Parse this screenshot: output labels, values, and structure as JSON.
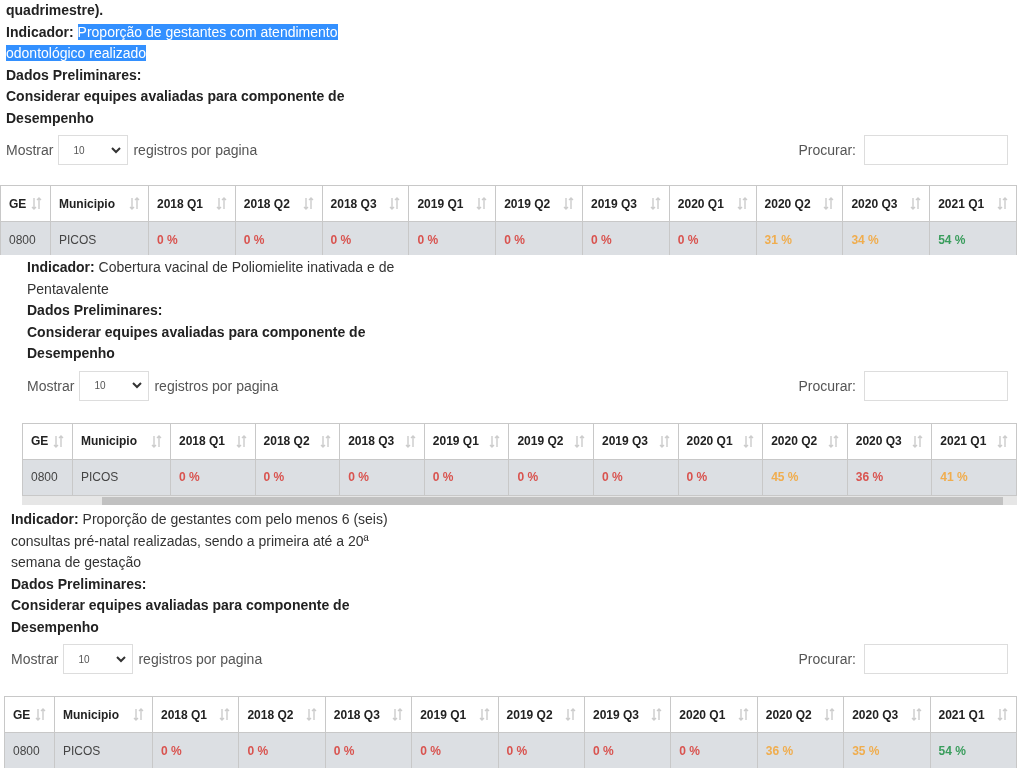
{
  "panels": [
    {
      "lead": "quadrimestre).",
      "indicator_label": "Indicador:",
      "indicator_text": "Proporção de gestantes com atendimento odontológico realizado",
      "indicator_selected": true,
      "notes": [
        "Dados Preliminares:",
        "Considerar equipes avaliadas para componente de Desempenho"
      ],
      "show_label": "Mostrar",
      "page_size": "10",
      "show_suffix": "registros por pagina",
      "search_label": "Procurar:",
      "columns": [
        "GE",
        "Municipio",
        "2018 Q1",
        "2018 Q2",
        "2018 Q3",
        "2019 Q1",
        "2019 Q2",
        "2019 Q3",
        "2020 Q1",
        "2020 Q2",
        "2020 Q3",
        "2021 Q1"
      ],
      "rows": [
        {
          "cells": [
            {
              "text": "0800"
            },
            {
              "text": "PICOS"
            },
            {
              "text": "0 %",
              "color": "#d9534f"
            },
            {
              "text": "0 %",
              "color": "#d9534f"
            },
            {
              "text": "0 %",
              "color": "#d9534f"
            },
            {
              "text": "0 %",
              "color": "#d9534f"
            },
            {
              "text": "0 %",
              "color": "#d9534f"
            },
            {
              "text": "0 %",
              "color": "#d9534f"
            },
            {
              "text": "0 %",
              "color": "#d9534f"
            },
            {
              "text": "31 %",
              "color": "#f0ad4e"
            },
            {
              "text": "34 %",
              "color": "#f0ad4e"
            },
            {
              "text": "54 %",
              "color": "#3a9d5d"
            }
          ]
        }
      ]
    },
    {
      "indicator_label": "Indicador:",
      "indicator_text": "Cobertura vacinal de Poliomielite inativada e de Pentavalente",
      "indicator_selected": false,
      "notes": [
        "Dados Preliminares:",
        "Considerar equipes avaliadas para componente de Desempenho"
      ],
      "show_label": "Mostrar",
      "page_size": "10",
      "show_suffix": "registros por pagina",
      "search_label": "Procurar:",
      "horizontal_scrollbar": true,
      "columns": [
        "GE",
        "Municipio",
        "2018 Q1",
        "2018 Q2",
        "2018 Q3",
        "2019 Q1",
        "2019 Q2",
        "2019 Q3",
        "2020 Q1",
        "2020 Q2",
        "2020 Q3",
        "2021 Q1"
      ],
      "rows": [
        {
          "cells": [
            {
              "text": "0800"
            },
            {
              "text": "PICOS"
            },
            {
              "text": "0 %",
              "color": "#d9534f"
            },
            {
              "text": "0 %",
              "color": "#d9534f"
            },
            {
              "text": "0 %",
              "color": "#d9534f"
            },
            {
              "text": "0 %",
              "color": "#d9534f"
            },
            {
              "text": "0 %",
              "color": "#d9534f"
            },
            {
              "text": "0 %",
              "color": "#d9534f"
            },
            {
              "text": "0 %",
              "color": "#d9534f"
            },
            {
              "text": "45 %",
              "color": "#f0ad4e"
            },
            {
              "text": "36 %",
              "color": "#d9534f"
            },
            {
              "text": "41 %",
              "color": "#f0ad4e"
            }
          ]
        }
      ]
    },
    {
      "indicator_label": "Indicador:",
      "indicator_text": "Proporção de gestantes com pelo menos 6 (seis) consultas pré-natal realizadas, sendo a primeira até a 20ª semana de gestação",
      "indicator_selected": false,
      "notes": [
        "Dados Preliminares:",
        "Considerar equipes avaliadas para componente de Desempenho"
      ],
      "show_label": "Mostrar",
      "page_size": "10",
      "show_suffix": "registros por pagina",
      "search_label": "Procurar:",
      "columns": [
        "GE",
        "Municipio",
        "2018 Q1",
        "2018 Q2",
        "2018 Q3",
        "2019 Q1",
        "2019 Q2",
        "2019 Q3",
        "2020 Q1",
        "2020 Q2",
        "2020 Q3",
        "2021 Q1"
      ],
      "rows": [
        {
          "cells": [
            {
              "text": "0800"
            },
            {
              "text": "PICOS"
            },
            {
              "text": "0 %",
              "color": "#d9534f"
            },
            {
              "text": "0 %",
              "color": "#d9534f"
            },
            {
              "text": "0 %",
              "color": "#d9534f"
            },
            {
              "text": "0 %",
              "color": "#d9534f"
            },
            {
              "text": "0 %",
              "color": "#d9534f"
            },
            {
              "text": "0 %",
              "color": "#d9534f"
            },
            {
              "text": "0 %",
              "color": "#d9534f"
            },
            {
              "text": "36 %",
              "color": "#f0ad4e"
            },
            {
              "text": "35 %",
              "color": "#f0ad4e"
            },
            {
              "text": "54 %",
              "color": "#3a9d5d"
            }
          ]
        }
      ]
    }
  ]
}
